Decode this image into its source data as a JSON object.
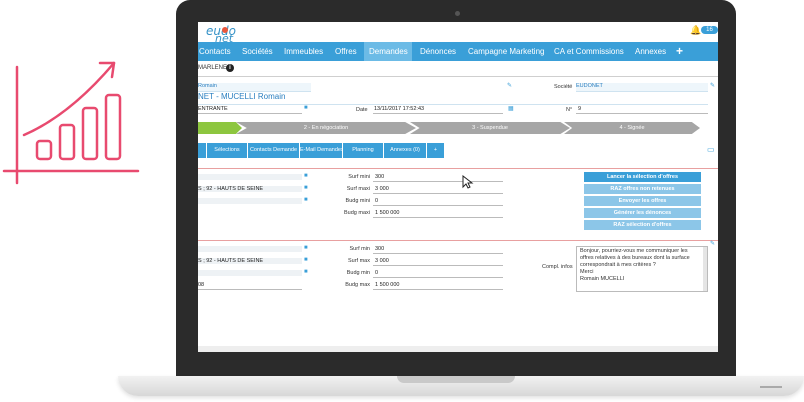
{
  "app": {
    "logo_top": "eudo",
    "logo_bottom": "net",
    "notification_count": "16",
    "accent_color": "#3a9fd8",
    "chart_icon_color": "#e84a6f"
  },
  "nav": {
    "items": [
      "Contacts",
      "Sociétés",
      "Immeubles",
      "Offres",
      "Demandes",
      "Dénonces",
      "Campagne Marketing",
      "CA et Commissions",
      "Annexes"
    ],
    "active": "Demandes",
    "add_label": "+"
  },
  "user": {
    "name": "MARLENE"
  },
  "record": {
    "top_left_value": "Romain",
    "societe_label": "Société",
    "societe_value": "EUDONET",
    "title": "NET - MUCELLI Romain",
    "type_value": "ENTRANTE",
    "date_label": "Date",
    "date_value": "13/11/2017 17:52:43",
    "number_label": "N°",
    "number_value": "9"
  },
  "steps": [
    "2 - En négociation",
    "3 - Suspendue",
    "4 - Signée"
  ],
  "tabs": [
    "Sélections",
    "Contacts Demande",
    "E-Mail Demandes",
    "Planning",
    "Annexes (0)",
    "+"
  ],
  "section1": {
    "left_values": [
      "",
      "S ; 92 - HAUTS DE SEINE",
      ""
    ],
    "fields": [
      {
        "label": "Surf mini",
        "value": "300"
      },
      {
        "label": "Surf maxi",
        "value": "3 000"
      },
      {
        "label": "Budg mini",
        "value": "0"
      },
      {
        "label": "Budg maxi",
        "value": "1 500 000"
      }
    ],
    "buttons": [
      "Lancer la sélection d'offres",
      "RAZ offres non retenues",
      "Envoyer les offres",
      "Générer les dénonces",
      "RAZ sélection d'offres"
    ]
  },
  "section2": {
    "left_values": [
      "",
      "S ; 92 - HAUTS DE SEINE",
      "",
      "08"
    ],
    "fields": [
      {
        "label": "Surf min",
        "value": "300"
      },
      {
        "label": "Surf max",
        "value": "3 000"
      },
      {
        "label": "Budg min",
        "value": "0"
      },
      {
        "label": "Budg max",
        "value": "1 500 000"
      }
    ],
    "compl_label": "Compl. infos",
    "comment_lines": [
      "Bonjour, pourriez-vous me communiquer les",
      "offres relatives à des bureaux dont la surface",
      "correspondrait à mes critères ?",
      "Merci",
      "",
      "Romain MUCELLI"
    ]
  }
}
